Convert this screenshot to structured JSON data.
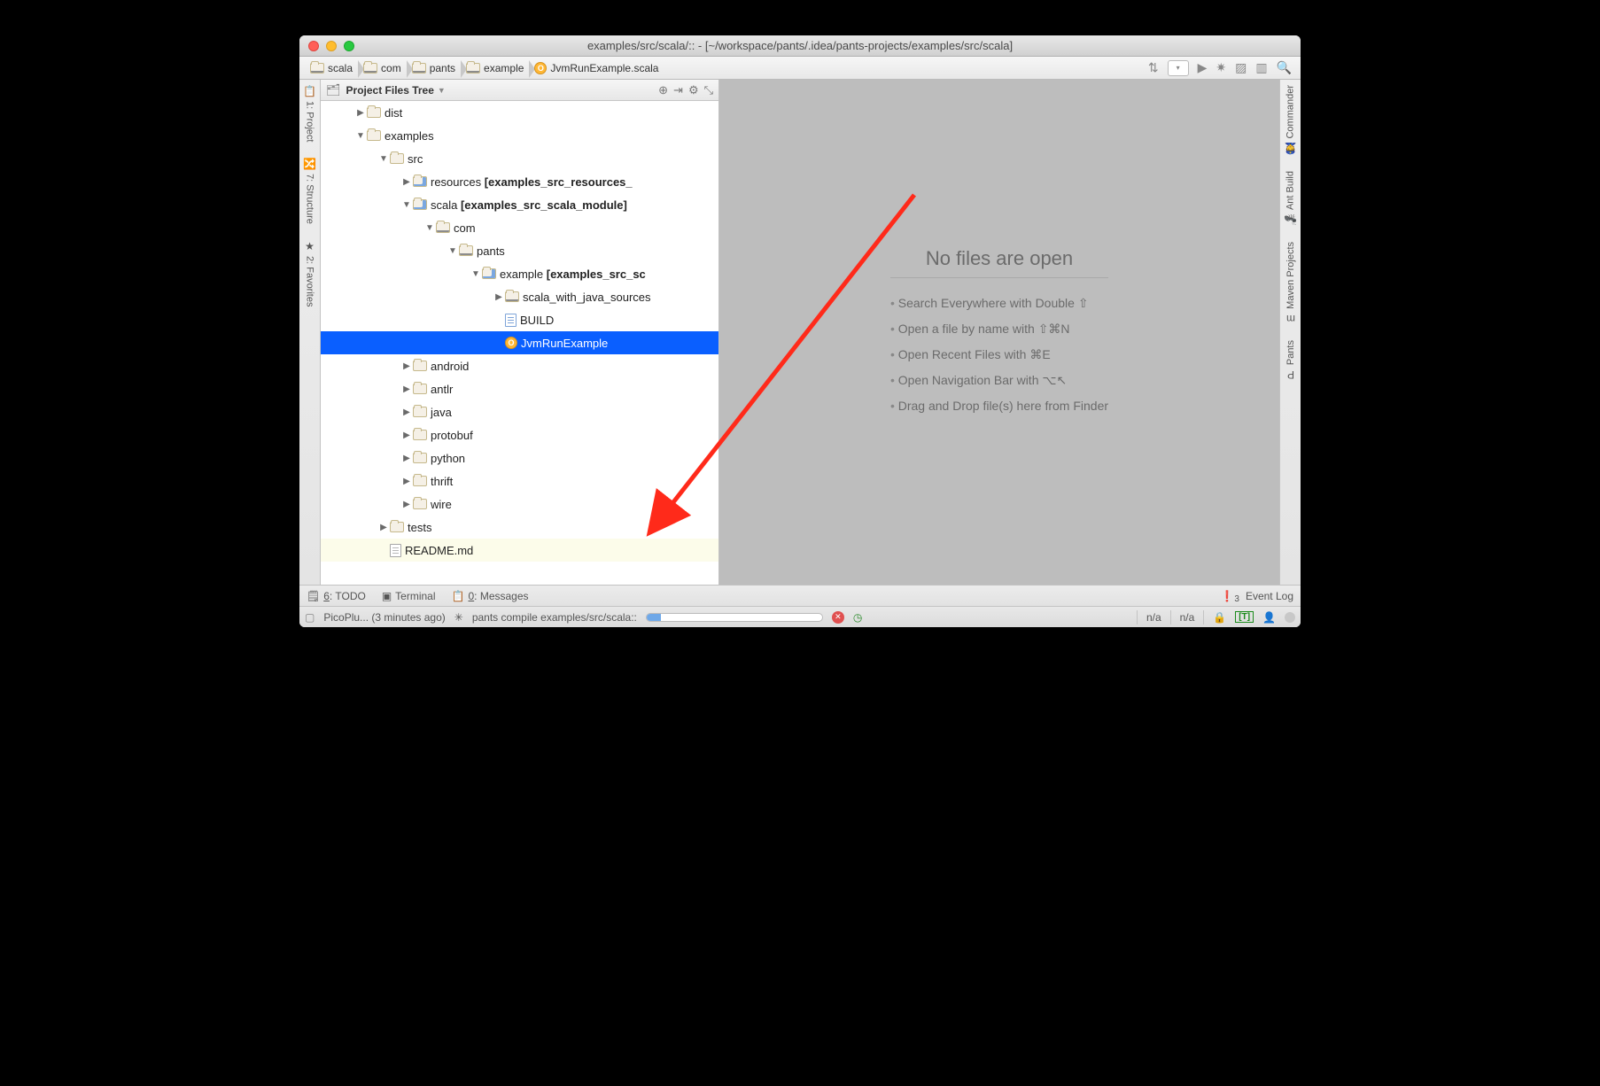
{
  "window": {
    "title": "examples/src/scala/:: - [~/workspace/pants/.idea/pants-projects/examples/src/scala]"
  },
  "breadcrumbs": [
    "scala",
    "com",
    "pants",
    "example",
    "JvmRunExample.scala"
  ],
  "project_panel": {
    "title": "Project Files Tree",
    "tree": [
      {
        "depth": 0,
        "arrow": "right",
        "icon": "folder",
        "label": "dist"
      },
      {
        "depth": 0,
        "arrow": "down",
        "icon": "folder",
        "label": "examples"
      },
      {
        "depth": 1,
        "arrow": "down",
        "icon": "folder",
        "label": "src"
      },
      {
        "depth": 2,
        "arrow": "right",
        "icon": "folder-module",
        "label": "resources",
        "suffix": " [examples_src_resources_"
      },
      {
        "depth": 2,
        "arrow": "down",
        "icon": "folder-module",
        "label": "scala",
        "suffix": " [examples_src_scala_module]"
      },
      {
        "depth": 3,
        "arrow": "down",
        "icon": "folder-pkg",
        "label": "com"
      },
      {
        "depth": 4,
        "arrow": "down",
        "icon": "folder-pkg",
        "label": "pants"
      },
      {
        "depth": 5,
        "arrow": "down",
        "icon": "folder-module",
        "label": "example",
        "suffix": " [examples_src_sc"
      },
      {
        "depth": 6,
        "arrow": "right",
        "icon": "folder-pkg",
        "label": "scala_with_java_sources"
      },
      {
        "depth": 6,
        "arrow": "none",
        "icon": "file-build",
        "label": "BUILD"
      },
      {
        "depth": 6,
        "arrow": "none",
        "icon": "ofile",
        "label": "JvmRunExample",
        "selected": true
      },
      {
        "depth": 2,
        "arrow": "right",
        "icon": "folder",
        "label": "android"
      },
      {
        "depth": 2,
        "arrow": "right",
        "icon": "folder",
        "label": "antlr"
      },
      {
        "depth": 2,
        "arrow": "right",
        "icon": "folder",
        "label": "java"
      },
      {
        "depth": 2,
        "arrow": "right",
        "icon": "folder",
        "label": "protobuf"
      },
      {
        "depth": 2,
        "arrow": "right",
        "icon": "folder",
        "label": "python"
      },
      {
        "depth": 2,
        "arrow": "right",
        "icon": "folder",
        "label": "thrift"
      },
      {
        "depth": 2,
        "arrow": "right",
        "icon": "folder",
        "label": "wire"
      },
      {
        "depth": 1,
        "arrow": "right",
        "icon": "folder",
        "label": "tests"
      },
      {
        "depth": 1,
        "arrow": "none",
        "icon": "file",
        "label": "README.md",
        "readme": true
      }
    ]
  },
  "left_tabs": [
    {
      "label": "1: Project",
      "icon": "📋"
    },
    {
      "label": "7: Structure",
      "icon": "🔀"
    },
    {
      "label": "2: Favorites",
      "icon": "★"
    }
  ],
  "right_tabs": [
    {
      "label": "Commander",
      "icon": "👮"
    },
    {
      "label": "Ant Build",
      "icon": "🐜"
    },
    {
      "label": "Maven Projects",
      "icon": "m"
    },
    {
      "label": "Pants",
      "icon": "P"
    }
  ],
  "empty_editor": {
    "heading": "No files are open",
    "tips": [
      "Search Everywhere with  Double ⇧",
      "Open a file by name with ⇧⌘N",
      "Open Recent Files with ⌘E",
      "Open Navigation Bar with  ⌥↖",
      "Drag and Drop file(s) here from Finder"
    ]
  },
  "tool_buttons": {
    "todo": "6: TODO",
    "terminal": "Terminal",
    "messages": "0: Messages",
    "event_log": "Event Log",
    "event_log_count": "3"
  },
  "statusbar": {
    "bg_task_label": "PicoPlu... (3 minutes ago)",
    "process_label": "pants compile examples/src/scala::",
    "right1": "n/a",
    "right2": "n/a"
  }
}
